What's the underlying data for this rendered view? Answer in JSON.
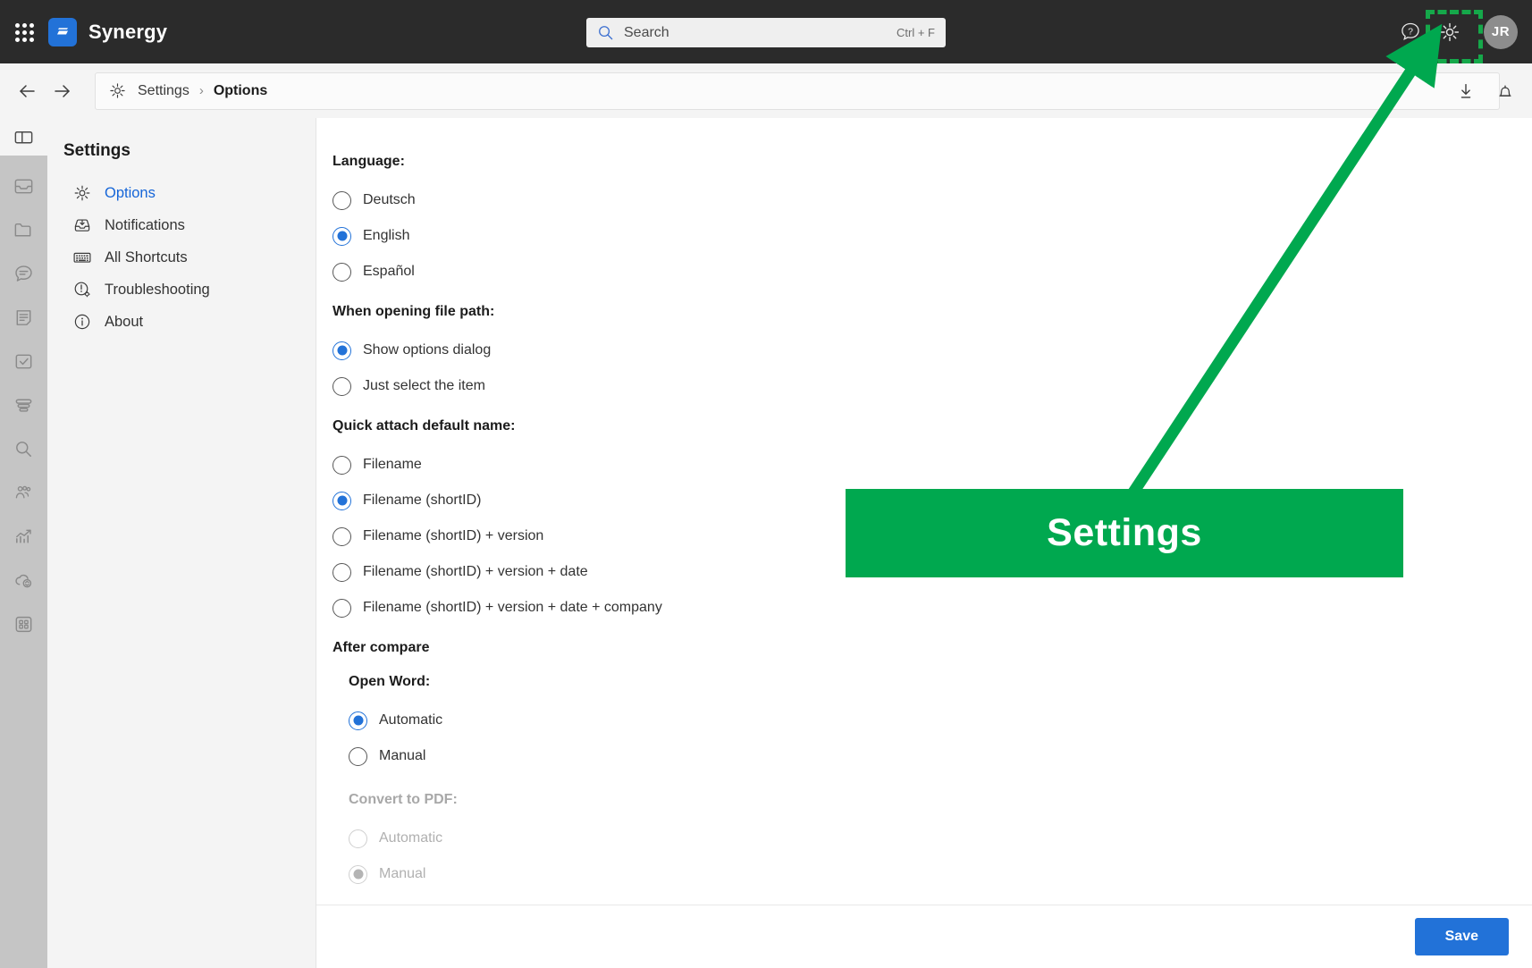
{
  "app": {
    "name": "Synergy",
    "logo_icon": "synergy-logo-icon",
    "waffle_icon": "app-grid-icon"
  },
  "search": {
    "placeholder": "Search",
    "value": "",
    "shortcut": "Ctrl + F",
    "icon": "search-icon"
  },
  "topbar": {
    "help_icon": "help-question-icon",
    "settings_icon": "gear-icon",
    "avatar_initials": "JR"
  },
  "breadcrumb": {
    "icon": "gear-icon",
    "parent": "Settings",
    "separator": "›",
    "current": "Options",
    "back_icon": "arrow-left-icon",
    "forward_icon": "arrow-right-icon",
    "download_icon": "download-icon",
    "notifications_icon": "bell-icon"
  },
  "rail": {
    "toggle_icon": "panel-toggle-icon",
    "items": [
      {
        "icon": "inbox-icon"
      },
      {
        "icon": "folder-icon"
      },
      {
        "icon": "chat-icon"
      },
      {
        "icon": "notes-icon"
      },
      {
        "icon": "task-check-icon"
      },
      {
        "icon": "filter-icon"
      },
      {
        "icon": "search-icon"
      },
      {
        "icon": "people-icon"
      },
      {
        "icon": "analytics-chart-icon"
      },
      {
        "icon": "cloud-sync-icon"
      },
      {
        "icon": "apps-grid-icon"
      }
    ]
  },
  "settings_nav": {
    "title": "Settings",
    "items": [
      {
        "label": "Options",
        "icon": "gear-icon",
        "active": true
      },
      {
        "label": "Notifications",
        "icon": "inbox-download-icon",
        "active": false
      },
      {
        "label": "All Shortcuts",
        "icon": "keyboard-icon",
        "active": false
      },
      {
        "label": "Troubleshooting",
        "icon": "alert-gear-icon",
        "active": false
      },
      {
        "label": "About",
        "icon": "info-icon",
        "active": false
      }
    ]
  },
  "options": {
    "language": {
      "label": "Language:",
      "choices": [
        {
          "label": "Deutsch",
          "selected": false
        },
        {
          "label": "English",
          "selected": true
        },
        {
          "label": "Español",
          "selected": false
        }
      ]
    },
    "file_path": {
      "label": "When opening file path:",
      "choices": [
        {
          "label": "Show options dialog",
          "selected": true
        },
        {
          "label": "Just select the item",
          "selected": false
        }
      ]
    },
    "quick_attach": {
      "label": "Quick attach default name:",
      "choices": [
        {
          "label": "Filename",
          "selected": false
        },
        {
          "label": "Filename (shortID)",
          "selected": true
        },
        {
          "label": "Filename (shortID) + version",
          "selected": false
        },
        {
          "label": "Filename (shortID) + version + date",
          "selected": false
        },
        {
          "label": "Filename (shortID) + version + date + company",
          "selected": false
        }
      ]
    },
    "after_compare": {
      "label": "After compare",
      "open_word": {
        "label": "Open Word:",
        "disabled": false,
        "choices": [
          {
            "label": "Automatic",
            "selected": true
          },
          {
            "label": "Manual",
            "selected": false
          }
        ]
      },
      "convert_pdf": {
        "label": "Convert to PDF:",
        "disabled": true,
        "choices": [
          {
            "label": "Automatic",
            "selected": false
          },
          {
            "label": "Manual",
            "selected": true
          }
        ]
      }
    }
  },
  "footer": {
    "save_label": "Save"
  },
  "annotation": {
    "callout_text": "Settings",
    "color": "#00a84f",
    "highlight_color": "#15a84a",
    "arrow_icon": "annotation-arrow-icon"
  },
  "colors": {
    "accent_blue": "#2272d8",
    "link_blue": "#1565d8",
    "header_bg": "#2b2b2b",
    "rail_bg": "#c5c5c5",
    "panel_bg": "#f4f4f4"
  }
}
